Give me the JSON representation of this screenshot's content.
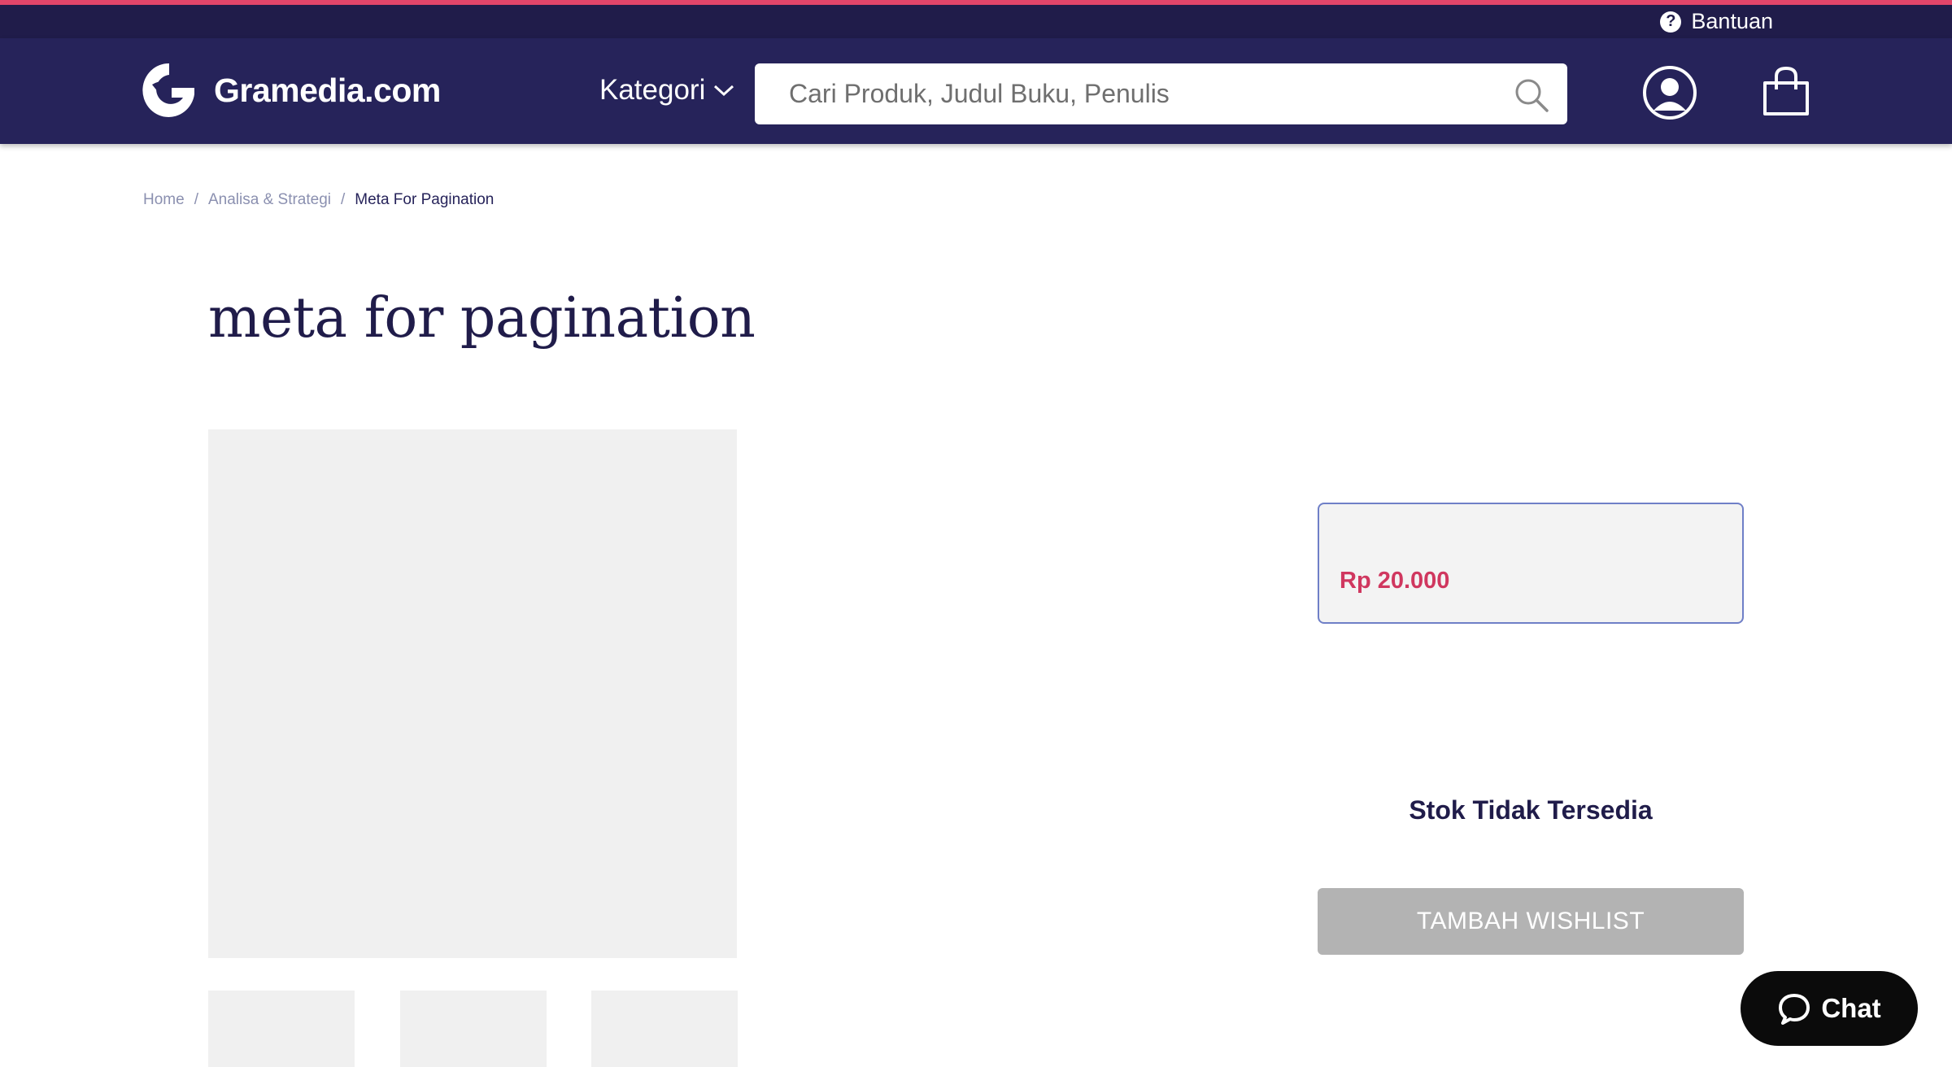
{
  "colors": {
    "accent": "#e2456a",
    "topbar": "#201c4a",
    "navbar": "#26235a",
    "price": "#d0375f",
    "button_disabled": "#b3b3b3",
    "chat": "#0b0b0b"
  },
  "topbar": {
    "help_icon": "question-circle-icon",
    "help_label": "Bantuan"
  },
  "navbar": {
    "logo_icon": "gramedia-logo-icon",
    "logo_text": "Gramedia.com",
    "kategori_label": "Kategori",
    "kategori_icon": "chevron-down-icon",
    "search_placeholder": "Cari Produk, Judul Buku, Penulis",
    "search_value": "",
    "search_icon": "search-icon",
    "account_icon": "user-icon",
    "cart_icon": "shopping-bag-icon"
  },
  "breadcrumb": {
    "items": [
      "Home",
      "Analisa & Strategi"
    ],
    "current": "Meta For Pagination",
    "separator": "/"
  },
  "product": {
    "title": "meta for pagination",
    "price": "Rp 20.000",
    "stock_status": "Stok Tidak Tersedia",
    "wishlist_button": "TAMBAH WISHLIST"
  },
  "chat": {
    "icon": "chat-bubble-icon",
    "label": "Chat"
  }
}
